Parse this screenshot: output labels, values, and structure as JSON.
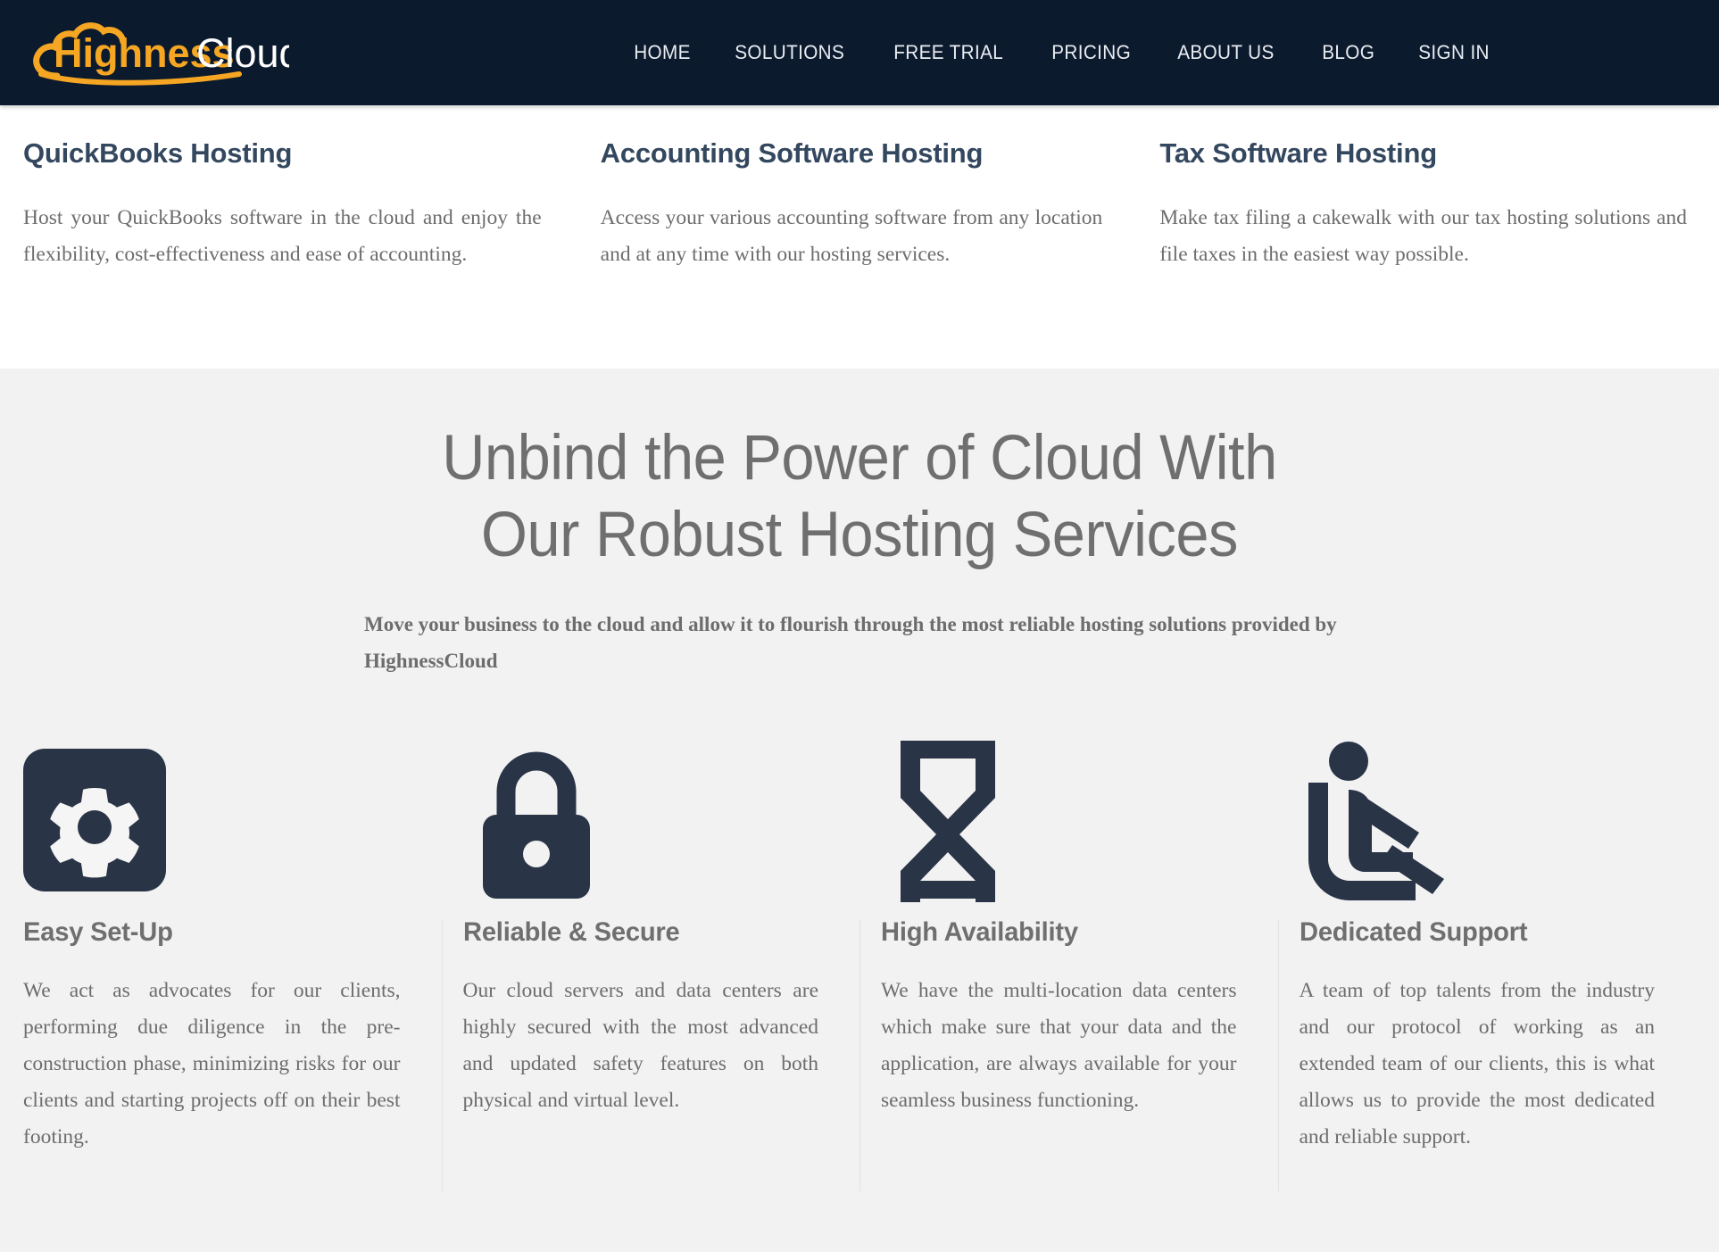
{
  "brand": {
    "name_part1": "Highness",
    "name_part2": "Cloud",
    "accent_color": "#f5a623",
    "header_bg": "#0c1a2d",
    "icon": "cloud-logo-icon"
  },
  "nav": {
    "items": [
      {
        "label": "HOME"
      },
      {
        "label": "SOLUTIONS"
      },
      {
        "label": "FREE TRIAL"
      },
      {
        "label": "PRICING"
      },
      {
        "label": "ABOUT US"
      },
      {
        "label": "BLOG"
      },
      {
        "label": "SIGN IN"
      }
    ]
  },
  "hosting": {
    "columns": [
      {
        "title": "QuickBooks Hosting",
        "text": "Host your QuickBooks software in the cloud and enjoy the flexibility, cost-effectiveness and ease of accounting."
      },
      {
        "title": "Accounting Software Hosting",
        "text": "Access your various accounting software from any location and at any time with our hosting services."
      },
      {
        "title": "Tax Software Hosting",
        "text": "Make tax filing a cakewalk with our tax hosting solutions and file taxes in the easiest way possible."
      }
    ]
  },
  "hero": {
    "title_line1": "Unbind the Power of Cloud With",
    "title_line2": "Our Robust Hosting Services",
    "subtitle": "Move your business to the cloud and allow it to flourish through the most reliable hosting solutions provided by HighnessCloud",
    "background_color": "#f2f2f2",
    "title_color": "#6f6f6f"
  },
  "features": {
    "icon_color": "#2a3447",
    "items": [
      {
        "icon": "gear-settings-icon",
        "title": "Easy Set-Up",
        "text": "We act as advocates for our clients, performing due diligence in the pre-construction phase, minimizing risks for our clients and starting projects off on their best footing."
      },
      {
        "icon": "padlock-icon",
        "title": "Reliable & Secure",
        "text": "Our cloud servers and data centers are highly secured with the most advanced and updated safety features on both physical and virtual level."
      },
      {
        "icon": "hourglass-icon",
        "title": "High Availability",
        "text": "We have the multi-location data centers which make sure that your data and the application, are always available for your seamless business functioning."
      },
      {
        "icon": "seated-person-support-icon",
        "title": "Dedicated Support",
        "text": "A team of top talents from the industry and our protocol of working as an extended team of our clients, this is what allows us to provide the most dedicated and reliable support."
      }
    ]
  }
}
